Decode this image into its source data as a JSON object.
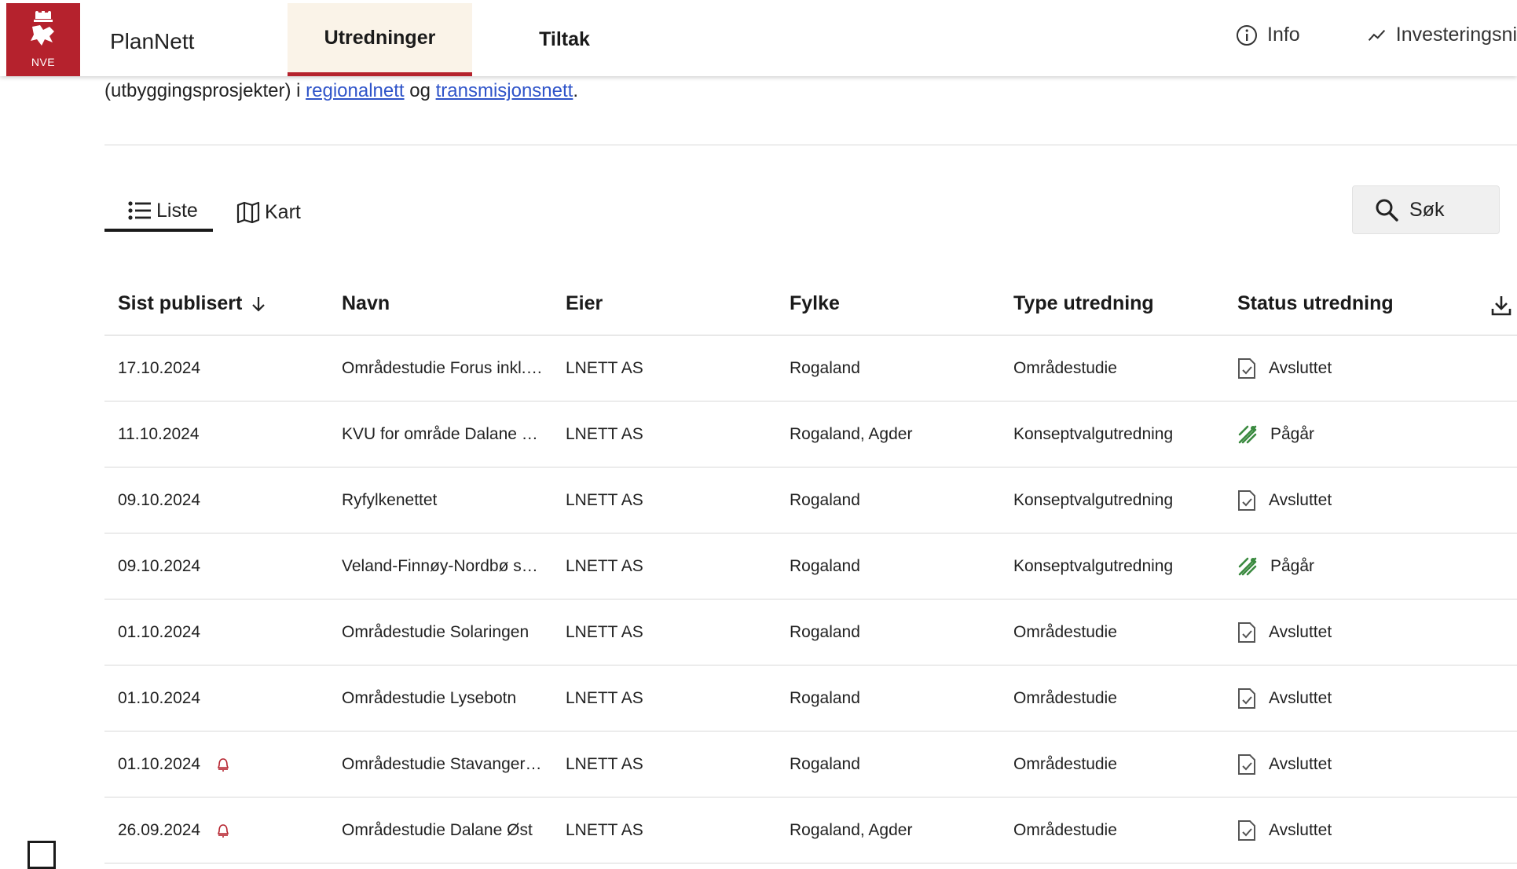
{
  "header": {
    "logo_text": "NVE",
    "app_name": "PlanNett",
    "tabs": [
      {
        "label": "Utredninger",
        "active": true
      },
      {
        "label": "Tiltak",
        "active": false
      }
    ],
    "info_label": "Info",
    "investment_label": "Investeringsni"
  },
  "intro": {
    "line2_prefix": "(utbyggingsprosjekter) i ",
    "link_regional": "regionalnett",
    "middle": " og ",
    "link_transmission": "transmisjonsnett",
    "suffix": "."
  },
  "view_tabs": [
    {
      "label": "Liste",
      "active": true
    },
    {
      "label": "Kart",
      "active": false
    }
  ],
  "search_label": "Søk",
  "columns": [
    "Sist publisert",
    "Navn",
    "Eier",
    "Fylke",
    "Type utredning",
    "Status utredning"
  ],
  "rows": [
    {
      "date": "17.10.2024",
      "bell": false,
      "name": "Områdestudie Forus inkl.…",
      "owner": "LNETT AS",
      "county": "Rogaland",
      "type": "Områdestudie",
      "status": "Avsluttet"
    },
    {
      "date": "11.10.2024",
      "bell": false,
      "name": "KVU for område Dalane …",
      "owner": "LNETT AS",
      "county": "Rogaland, Agder",
      "type": "Konseptvalgutredning",
      "status": "Pågår"
    },
    {
      "date": "09.10.2024",
      "bell": false,
      "name": "Ryfylkenettet",
      "owner": "LNETT AS",
      "county": "Rogaland",
      "type": "Konseptvalgutredning",
      "status": "Avsluttet"
    },
    {
      "date": "09.10.2024",
      "bell": false,
      "name": "Veland-Finnøy-Nordbø s…",
      "owner": "LNETT AS",
      "county": "Rogaland",
      "type": "Konseptvalgutredning",
      "status": "Pågår"
    },
    {
      "date": "01.10.2024",
      "bell": false,
      "name": "Områdestudie Solaringen",
      "owner": "LNETT AS",
      "county": "Rogaland",
      "type": "Områdestudie",
      "status": "Avsluttet"
    },
    {
      "date": "01.10.2024",
      "bell": false,
      "name": "Områdestudie Lysebotn",
      "owner": "LNETT AS",
      "county": "Rogaland",
      "type": "Områdestudie",
      "status": "Avsluttet"
    },
    {
      "date": "01.10.2024",
      "bell": true,
      "name": "Områdestudie Stavanger…",
      "owner": "LNETT AS",
      "county": "Rogaland",
      "type": "Områdestudie",
      "status": "Avsluttet"
    },
    {
      "date": "26.09.2024",
      "bell": true,
      "name": "Områdestudie Dalane Øst",
      "owner": "LNETT AS",
      "county": "Rogaland, Agder",
      "type": "Områdestudie",
      "status": "Avsluttet"
    }
  ],
  "colors": {
    "brand": "#b5222d",
    "link": "#2f54c9",
    "in_progress": "#3a8a3f"
  }
}
